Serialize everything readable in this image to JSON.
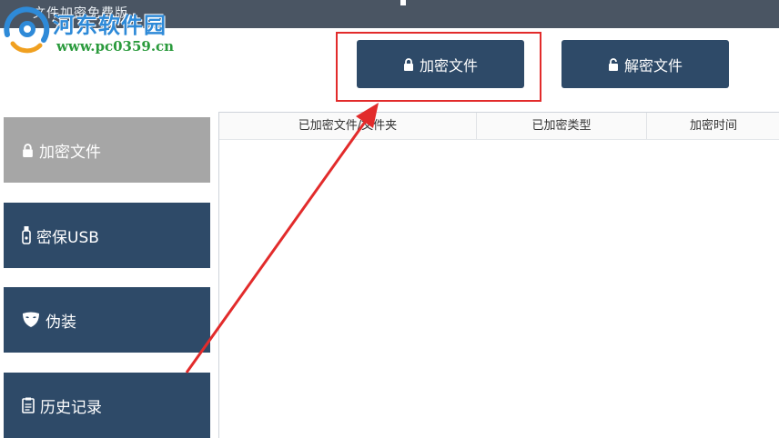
{
  "window": {
    "title": "文件加密免费版"
  },
  "watermark": {
    "name": "河东软件园",
    "url": "www.pc0359.cn"
  },
  "toolbar": {
    "encrypt_label": "加密文件",
    "decrypt_label": "解密文件"
  },
  "sidebar": {
    "items": [
      {
        "label": "加密文件",
        "icon": "lock-icon",
        "active": true
      },
      {
        "label": "密保USB",
        "icon": "usb-icon",
        "active": false
      },
      {
        "label": "伪装",
        "icon": "mask-icon",
        "active": false
      },
      {
        "label": "历史记录",
        "icon": "clipboard-icon",
        "active": false
      }
    ]
  },
  "table": {
    "columns": [
      "已加密文件/文件夹",
      "已加密类型",
      "加密时间"
    ],
    "rows": []
  },
  "colors": {
    "accent": "#2e4a68",
    "active_item": "#a6a6a6",
    "annotation": "#e22b2b"
  }
}
